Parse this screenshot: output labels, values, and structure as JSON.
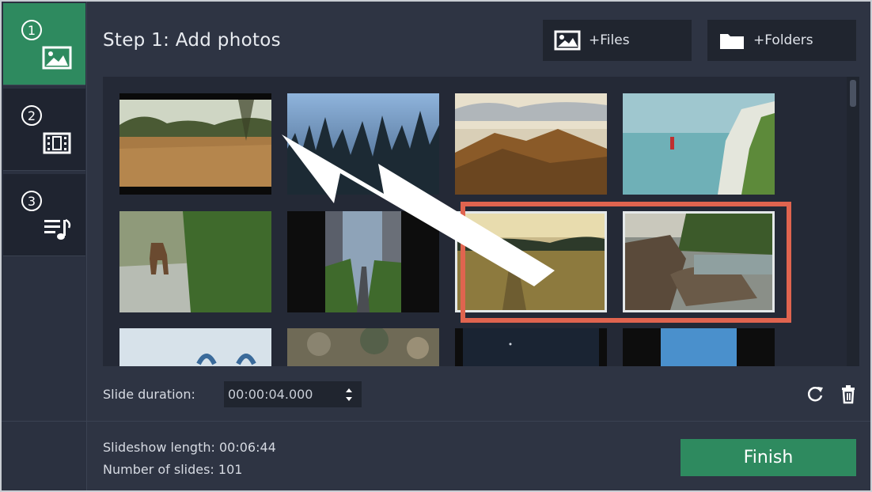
{
  "sidebar": {
    "steps": [
      {
        "number": "①",
        "icon": "photo-icon",
        "active": true
      },
      {
        "number": "②",
        "icon": "film-clip-icon",
        "active": false
      },
      {
        "number": "③",
        "icon": "music-list-icon",
        "active": false
      }
    ]
  },
  "header": {
    "title": "Step 1: Add photos",
    "add_files_label": "+Files",
    "add_folders_label": "+Folders"
  },
  "slide_duration": {
    "label": "Slide duration:",
    "value": "00:00:04.000"
  },
  "stats": {
    "length_label": "Slideshow length: 00:06:44",
    "count_label": "Number of slides: 101"
  },
  "finish_label": "Finish",
  "colors": {
    "accent_green": "#2e8a5f",
    "highlight": "#e0644f",
    "background": "#2e3443"
  }
}
